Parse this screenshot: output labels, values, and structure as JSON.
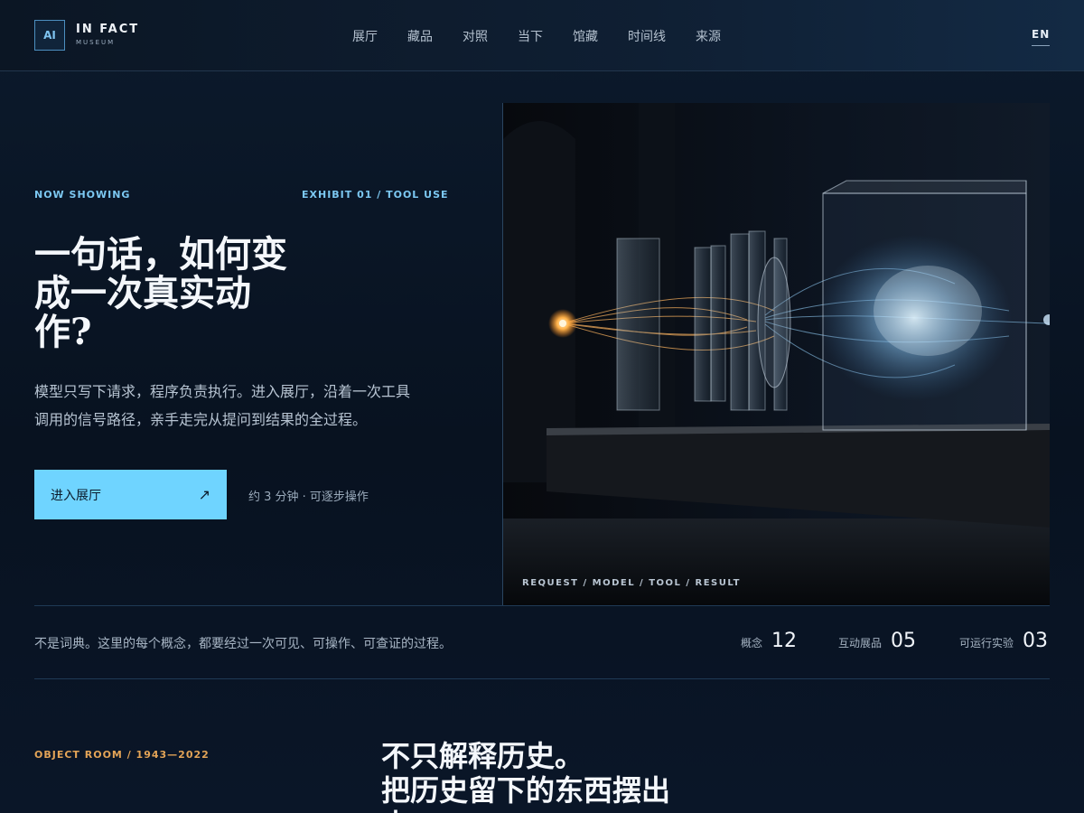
{
  "header": {
    "logo_mark": "AI",
    "brand_name": "IN FACT",
    "brand_sub": "MUSEUM",
    "nav": [
      "展厅",
      "藏品",
      "对照",
      "当下",
      "馆藏",
      "时间线",
      "来源"
    ],
    "lang": "EN"
  },
  "hero": {
    "tag_left": "NOW SHOWING",
    "tag_right": "EXHIBIT 01 / TOOL USE",
    "headline_lines": [
      "一句话，如何变",
      "成一次真实动",
      "作?"
    ],
    "lede_lines": [
      "模型只写下请求，程序负责执行。进入展厅，沿着一次工具",
      "调用的信号路径，亲手走完从提问到结果的全过程。"
    ],
    "cta_label": "进入展厅",
    "cta_arrow": "↗",
    "cta_note": "约 3 分钟 · 可逐步操作",
    "image_caption": "REQUEST / MODEL / TOOL / RESULT"
  },
  "stats": {
    "statement": "不是词典。这里的每个概念，都要经过一次可见、可操作、可查证的过程。",
    "items": [
      {
        "label": "概念",
        "value": "12"
      },
      {
        "label": "互动展品",
        "value": "05"
      },
      {
        "label": "可运行实验",
        "value": "03"
      }
    ]
  },
  "section": {
    "tag": "OBJECT ROOM / 1943—2022",
    "title_lines": [
      "不只解释历史。",
      "把历史留下的东西摆出",
      "来。"
    ]
  },
  "colors": {
    "accent": "#6fd4ff",
    "tag_blue": "#7cc8f2",
    "tag_orange": "#e3a457",
    "background": "#0a1422"
  }
}
